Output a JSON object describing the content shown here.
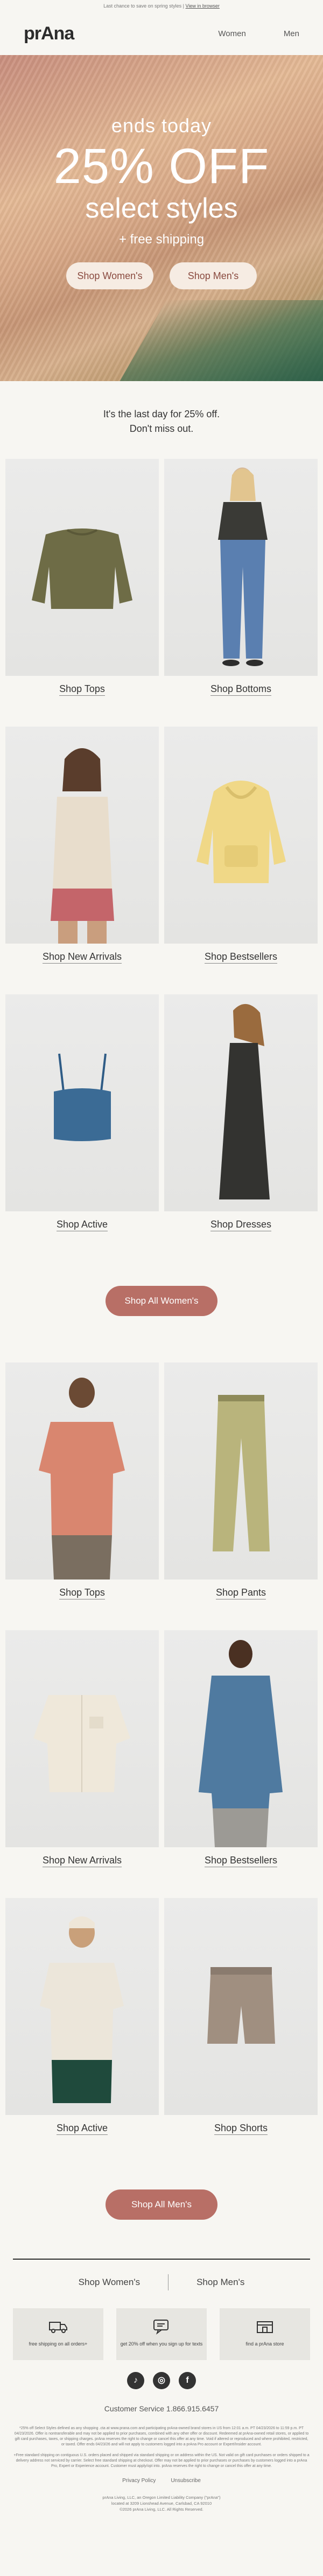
{
  "preheader": {
    "text": "Last chance to save on spring styles |",
    "link": "View in browser"
  },
  "brand": {
    "logo": "prAna"
  },
  "nav": {
    "women": "Women",
    "men": "Men"
  },
  "hero": {
    "kicker": "ends today",
    "headline": "25% OFF",
    "sub": "select styles",
    "shipping": "+ free shipping",
    "btn_women": "Shop Women's",
    "btn_men": "Shop Men's"
  },
  "intro": {
    "line1": "It's the last day for 25% off.",
    "line2": "Don't miss out."
  },
  "women": {
    "tiles": [
      {
        "label": "Shop Tops"
      },
      {
        "label": "Shop Bottoms"
      },
      {
        "label": "Shop New Arrivals"
      },
      {
        "label": "Shop Bestsellers"
      },
      {
        "label": "Shop Active"
      },
      {
        "label": "Shop Dresses"
      }
    ],
    "cta": "Shop All Women's"
  },
  "men": {
    "tiles": [
      {
        "label": "Shop Tops"
      },
      {
        "label": "Shop Pants"
      },
      {
        "label": "Shop New Arrivals"
      },
      {
        "label": "Shop Bestsellers"
      },
      {
        "label": "Shop Active"
      },
      {
        "label": "Shop Shorts"
      }
    ],
    "cta": "Shop All Men's"
  },
  "footer_nav": {
    "women": "Shop Women's",
    "men": "Shop Men's"
  },
  "perks": [
    {
      "icon": "truck-icon",
      "text": "free shipping on all orders+"
    },
    {
      "icon": "chat-icon",
      "text": "get 20% off when you sign up for texts"
    },
    {
      "icon": "store-icon",
      "text": "find a prAna store"
    }
  ],
  "social": [
    {
      "icon": "tiktok-icon",
      "glyph": "♪"
    },
    {
      "icon": "instagram-icon",
      "glyph": "◎"
    },
    {
      "icon": "facebook-icon",
      "glyph": "f"
    }
  ],
  "customer_service": "Customer Service 1.866.915.6457",
  "legal": {
    "p1": "*25% off Select Styles defined as any shopping .cta at www.prana.com and participating prAna-owned brand stores in US from 12:01 a.m. PT 04/23/2026 to 11:59 p.m. PT 04/23/2026. Offer is nontransferable and may not be applied to prior purchases, combined with any other offer or discount. Redeemed at prAna-owned retail stores, or applied to gift card purchases, taxes, or shipping charges. prAna reserves the right to change or cancel this offer at any time. Void if altered or reproduced and where prohibited, restricted, or taxed. Offer ends 04/23/26 and will not apply to customers logged into a prAna Pro account or Expert/Insider account.",
    "p2": "+Free standard shipping on contiguous U.S. orders placed and shipped via standard shipping or on address within the US. Not valid on gift card purchases or orders shipped to a delivery address not serviced by carrier. Select free standard shipping at checkout. Offer may not be applied to prior purchases or purchases by customers logged into a prAna Pro, Expert or Experience account. Customer must apply/opt into. prAna reserves the right to change or cancel this offer at any time."
  },
  "footer_links": {
    "privacy": "Privacy Policy",
    "unsubscribe": "Unsubscribe"
  },
  "address": {
    "line1": "prAna Living, LLC, an Oregon Limited Liability Company (\"prAna\")",
    "line2": "located at 3209 Lionshead Avenue, Carlsbad, CA 92010",
    "line3": "©2026 prAna Living, LLC. All Rights Reserved."
  },
  "colors": {
    "background": "#f7f6f2",
    "accent_button": "#b86f66",
    "hero_button": "#f6ece3",
    "text": "#333333"
  }
}
